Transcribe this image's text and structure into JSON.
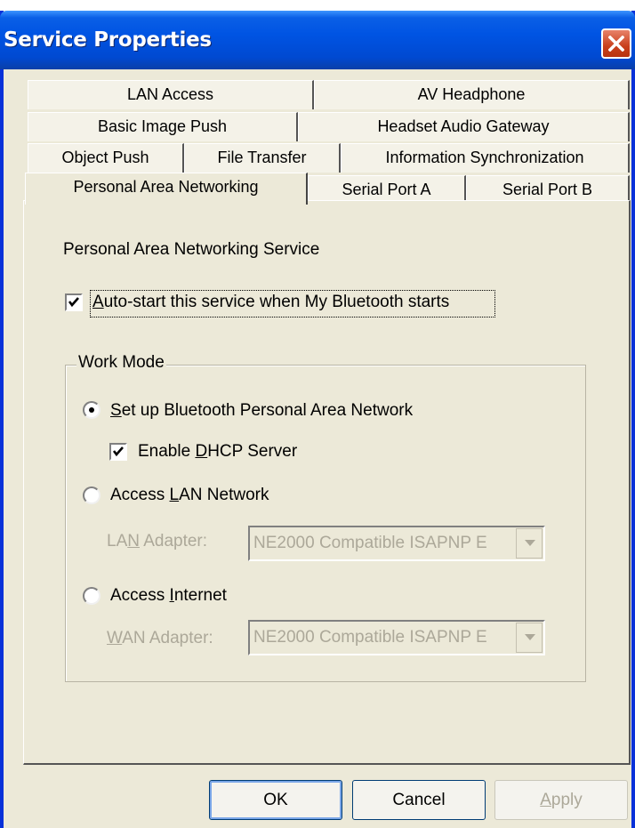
{
  "window": {
    "title": "Service Properties"
  },
  "tabs": {
    "row1": [
      "LAN Access",
      "AV Headphone"
    ],
    "row2": [
      "Basic Image Push",
      "Headset Audio Gateway"
    ],
    "row3": [
      "Object Push",
      "File Transfer",
      "Information Synchronization"
    ],
    "row4": [
      "Personal Area Networking",
      "Serial Port A",
      "Serial Port B"
    ],
    "active": "Personal Area Networking"
  },
  "panel": {
    "heading": "Personal Area Networking Service",
    "autostart": {
      "label_pre": "",
      "label_u": "A",
      "label_post": "uto-start this service when My Bluetooth starts",
      "checked": true
    },
    "work_mode": {
      "label": "Work Mode",
      "setup_pan": {
        "label_pre": "",
        "label_u": "S",
        "label_post": "et up Bluetooth Personal Area Network",
        "selected": true
      },
      "dhcp": {
        "label_pre": "Enable ",
        "label_u": "D",
        "label_post": "HCP Server",
        "checked": true
      },
      "access_lan": {
        "label_pre": "Access ",
        "label_u": "L",
        "label_post": "AN Network",
        "selected": false
      },
      "lan_adapter": {
        "label_pre": "LA",
        "label_u": "N",
        "label_post": " Adapter:",
        "value": "NE2000 Compatible ISAPNP E"
      },
      "access_internet": {
        "label_pre": "Access ",
        "label_u": "I",
        "label_post": "nternet",
        "selected": false
      },
      "wan_adapter": {
        "label_pre": "",
        "label_u": "W",
        "label_post": "AN Adapter:",
        "value": "NE2000 Compatible ISAPNP E"
      }
    }
  },
  "buttons": {
    "ok": "OK",
    "cancel": "Cancel",
    "apply": {
      "pre": "",
      "u": "A",
      "post": "pply"
    }
  },
  "icons": {
    "close": "close-icon",
    "checkmark": "checkmark-icon",
    "dropdown": "chevron-down-icon"
  }
}
